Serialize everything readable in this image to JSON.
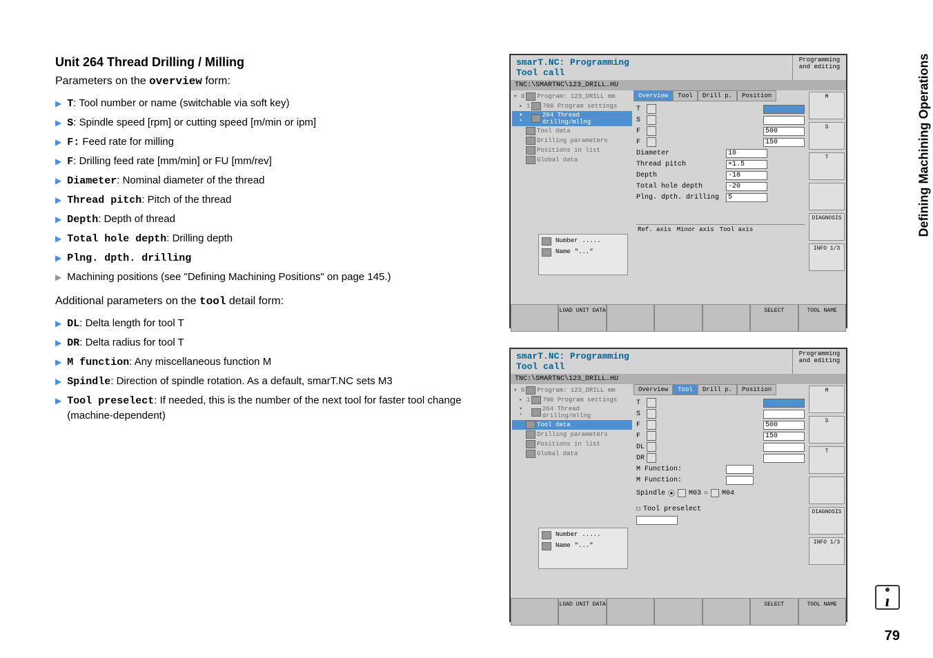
{
  "page": {
    "unit_title": "Unit 264 Thread Drilling / Milling",
    "subtitle_prefix": "Parameters on the ",
    "subtitle_form": "overview",
    "subtitle_suffix": " form:",
    "additional_prefix": "Additional parameters on the ",
    "additional_form": "tool",
    "additional_suffix": " detail form:",
    "sidebar_title": "Defining Machining Operations",
    "page_number": "79"
  },
  "params_overview": [
    {
      "key": "T",
      "desc": ": Tool number or name (switchable via soft key)"
    },
    {
      "key": "S",
      "desc": ": Spindle speed [rpm] or cutting speed [m/min or ipm]"
    },
    {
      "key": "F:",
      "desc": " Feed rate for milling"
    },
    {
      "key": "F",
      "desc": ": Drilling feed rate [mm/min] or FU [mm/rev]"
    },
    {
      "key": "Diameter",
      "desc": ": Nominal diameter of the thread"
    },
    {
      "key": "Thread pitch",
      "desc": ": Pitch of the thread"
    },
    {
      "key": "Depth",
      "desc": ": Depth of thread"
    },
    {
      "key": "Total hole depth",
      "desc": ": Drilling depth"
    },
    {
      "key": "Plng. dpth. drilling",
      "desc": ""
    }
  ],
  "params_positions": "Machining positions (see \"Defining Machining Positions\" on page 145.)",
  "params_tool": [
    {
      "key": "DL",
      "desc": ": Delta length for tool T"
    },
    {
      "key": "DR",
      "desc": ": Delta radius for tool T"
    },
    {
      "key": "M function",
      "desc": ": Any miscellaneous function M"
    },
    {
      "key": "Spindle",
      "desc": ": Direction of spindle rotation. As a default, smarT.NC sets M3"
    },
    {
      "key": "Tool preselect",
      "desc": ": If needed, this is the number of the next tool for faster tool change (machine-dependent)"
    }
  ],
  "screenshot": {
    "title_line1": "smarT.NC: Programming",
    "title_line2": "Tool call",
    "mode": "Programming and editing",
    "path": "TNC:\\SMARTNC\\123_DRILL.HU",
    "tree": [
      {
        "label": "Program: 123_DRILL mm",
        "indent": 0
      },
      {
        "label": "700 Program settings",
        "indent": 1
      },
      {
        "label": "264 Thread drillng/mllng",
        "indent": 1,
        "active_in": 1
      },
      {
        "label": "Tool data",
        "indent": 2,
        "active_in": 2
      },
      {
        "label": "Drilling parameters",
        "indent": 2
      },
      {
        "label": "Positions in list",
        "indent": 2
      },
      {
        "label": "Global data",
        "indent": 2
      }
    ],
    "helper_number_label": "Number",
    "helper_number_val": ".....",
    "helper_name_label": "Name",
    "helper_name_val": "\"...\"",
    "tabs": [
      "Overview",
      "Tool",
      "Drill p.",
      "Position"
    ],
    "overview_fields": {
      "T": "",
      "S": "",
      "F1": "500",
      "F2": "150",
      "diameter_label": "Diameter",
      "diameter": "10",
      "pitch_label": "Thread pitch",
      "pitch": "+1.5",
      "depth_label": "Depth",
      "depth": "-18",
      "total_label": "Total hole depth",
      "total": "-20",
      "plng_label": "Plng. dpth. drilling",
      "plng": "5",
      "axis_ref": "Ref. axis",
      "axis_minor": "Minor axis",
      "axis_tool": "Tool axis"
    },
    "tool_fields": {
      "T": "",
      "S": "",
      "F1": "500",
      "F2": "150",
      "DL": "",
      "DR": "",
      "mfunc_label": "M Function:",
      "spindle_label": "Spindle",
      "m03": "M03",
      "m04": "M04",
      "preselect_label": "Tool preselect"
    },
    "sidebar_buttons": [
      "M",
      "S",
      "T",
      "",
      "DIAGNOSIS",
      "INFO 1/3"
    ],
    "footer": {
      "load": "LOAD UNIT DATA",
      "select": "SELECT",
      "toolname": "TOOL NAME"
    }
  }
}
